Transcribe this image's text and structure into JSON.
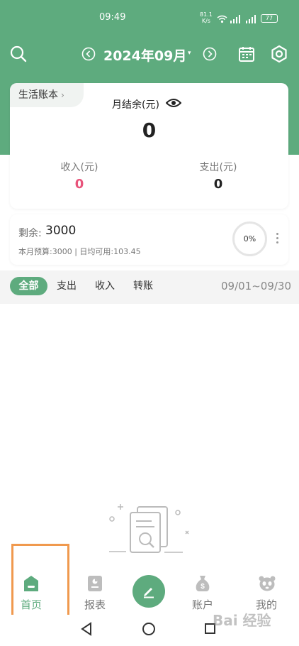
{
  "status_bar": {
    "time": "09:49",
    "net_speed_value": "81.1",
    "net_speed_unit": "K/s",
    "battery": "77"
  },
  "header": {
    "title": "2024年09月",
    "caret": "▾"
  },
  "summary": {
    "book_name": "生活账本",
    "book_chevron": "›",
    "balance_label": "月结余(元)",
    "balance_value": "0",
    "income_label": "收入(元)",
    "income_value": "0",
    "expense_label": "支出(元)",
    "expense_value": "0"
  },
  "budget": {
    "remaining_label": "剩余:",
    "remaining_value": "3000",
    "detail": "本月预算:3000 | 日均可用:103.45",
    "progress_text": "0%",
    "progress_fraction": 0
  },
  "filter": {
    "tabs": [
      {
        "label": "全部",
        "active": true
      },
      {
        "label": "支出",
        "active": false
      },
      {
        "label": "收入",
        "active": false
      },
      {
        "label": "转账",
        "active": false
      }
    ],
    "date_range": "09/01~09/30"
  },
  "nav": {
    "items": [
      {
        "label": "首页",
        "icon": "home-icon",
        "active": true
      },
      {
        "label": "报表",
        "icon": "report-icon",
        "active": false
      },
      {
        "label": "",
        "icon": "pen-icon",
        "active": false
      },
      {
        "label": "账户",
        "icon": "money-bag-icon",
        "active": false
      },
      {
        "label": "我的",
        "icon": "panda-icon",
        "active": false
      }
    ]
  },
  "watermark": "Bai 经验",
  "colors": {
    "accent": "#5eab7e",
    "income": "#e8537a",
    "highlight": "#f0994e"
  }
}
